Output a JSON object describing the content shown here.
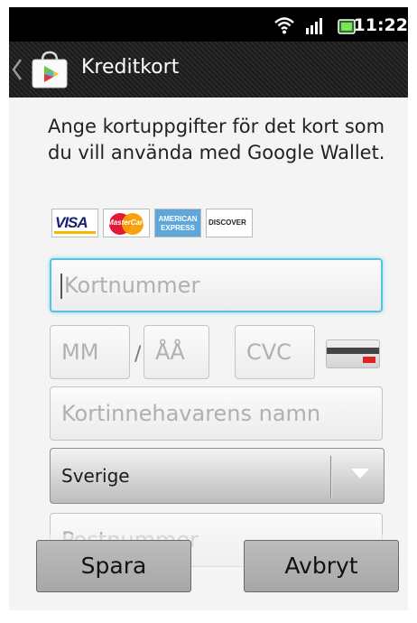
{
  "status_bar": {
    "time": "11:22",
    "icons": [
      "wifi-icon",
      "signal-icon",
      "battery-icon"
    ]
  },
  "action_bar": {
    "title": "Kreditkort",
    "icon": "google-play-store-icon",
    "back_icon": "back-chevron-icon"
  },
  "intro_text": "Ange kortuppgifter för det kort som du vill använda med Google Wallet.",
  "card_logos": [
    {
      "name": "VISA",
      "text": "VISA"
    },
    {
      "name": "MasterCard",
      "text": "MasterCard"
    },
    {
      "name": "American Express",
      "text": "AMERICAN EXPRESS"
    },
    {
      "name": "Discover",
      "text": "DISCOVER"
    }
  ],
  "form": {
    "card_number_placeholder": "Kortnummer",
    "month_placeholder": "MM",
    "date_separator": "/",
    "year_placeholder": "ÅÅ",
    "cvc_placeholder": "CVC",
    "cardholder_placeholder": "Kortinnehavarens namn",
    "country_selected": "Sverige",
    "postal_placeholder": "Postnummer"
  },
  "buttons": {
    "save": "Spara",
    "cancel": "Avbryt"
  },
  "colors": {
    "accent_focus": "#58c1dd",
    "action_bar": "#1e1e1e",
    "background": "#f4f4f4"
  }
}
